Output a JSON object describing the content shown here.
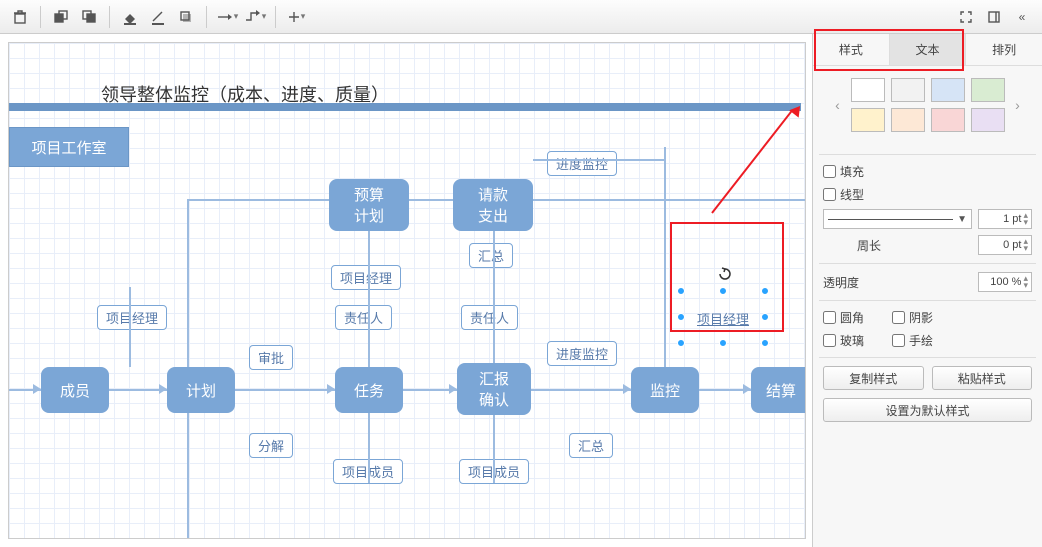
{
  "toolbar": {
    "icons": [
      "delete",
      "copy",
      "paste",
      "fill",
      "stroke",
      "shadow",
      "arrow-right",
      "connector",
      "plus",
      "expand",
      "collapse",
      "chevrons"
    ]
  },
  "diagram": {
    "title": "领导整体监控（成本、进度、质量）",
    "swimlane_header": "项目工作室",
    "nodes": {
      "members": "成员",
      "plan": "计划",
      "task": "任务",
      "report_confirm": "汇报\n确认",
      "monitor": "监控",
      "settle": "结算",
      "budget_plan": "预算\n计划",
      "request_pay": "请款\n支出"
    },
    "labels": {
      "pm1": "项目经理",
      "pm2": "项目经理",
      "approve": "审批",
      "decompose": "分解",
      "responsible1": "责任人",
      "responsible2": "责任人",
      "members1": "项目成员",
      "members2": "项目成员",
      "summary1": "汇总",
      "summary2": "汇总",
      "progress1": "进度监控",
      "progress2": "进度监控"
    },
    "selected_text": "项目经理"
  },
  "panel": {
    "tabs": {
      "style": "样式",
      "text": "文本",
      "arrange": "排列"
    },
    "swatches": [
      "#ffffff",
      "#f2f2f2",
      "#d6e4f6",
      "#d9ecd2",
      "#fff2cc",
      "#fde8d6",
      "#f9d6d6",
      "#e9dff3"
    ],
    "fill_label": "填充",
    "line_label": "线型",
    "line_width": "1 pt",
    "perimeter_label": "周长",
    "perimeter_value": "0 pt",
    "opacity_label": "透明度",
    "opacity_value": "100 %",
    "rounded": "圆角",
    "shadow": "阴影",
    "glass": "玻璃",
    "handdrawn": "手绘",
    "copy_style": "复制样式",
    "paste_style": "粘贴样式",
    "set_default": "设置为默认样式"
  }
}
